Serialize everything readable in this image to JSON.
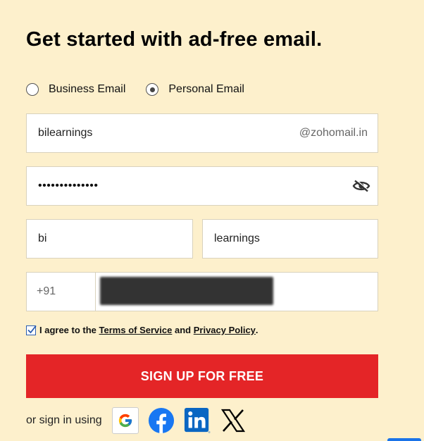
{
  "page": {
    "title": "Get started with ad-free email."
  },
  "account_type": {
    "options": [
      {
        "label": "Business Email",
        "selected": false
      },
      {
        "label": "Personal Email",
        "selected": true
      }
    ]
  },
  "form": {
    "email": {
      "value": "bilearnings",
      "domain_suffix": "@zohomail.in"
    },
    "password": {
      "masked_value": "••••••••••••••"
    },
    "first_name": {
      "value": "bi"
    },
    "last_name": {
      "value": "learnings"
    },
    "phone": {
      "country_code": "+91",
      "number_redacted": true
    }
  },
  "agreement": {
    "checked": true,
    "prefix": "I agree to the",
    "terms_link": "Terms of Service",
    "and": "and",
    "privacy_link": "Privacy Policy",
    "suffix": "."
  },
  "signup_button": {
    "label": "SIGN UP FOR FREE",
    "color": "#e42527"
  },
  "social": {
    "label": "or sign in using",
    "providers": [
      "google-icon",
      "facebook-icon",
      "linkedin-icon",
      "x-icon"
    ]
  },
  "colors": {
    "background": "#fdf0cc",
    "accent_red": "#e42527",
    "facebook_blue": "#1877f2",
    "linkedin_blue": "#0a66c2"
  }
}
